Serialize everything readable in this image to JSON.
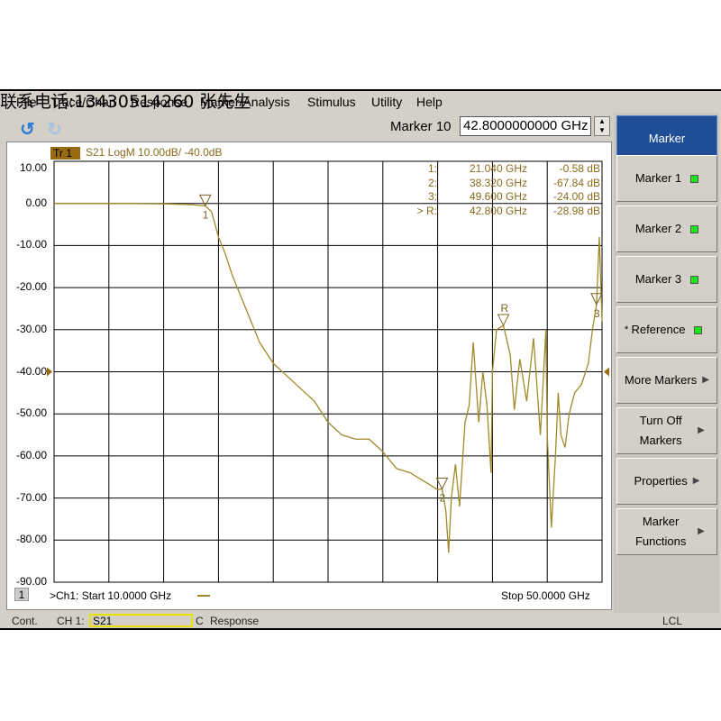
{
  "watermark": "联系电话:13430514260 张先生",
  "menu": [
    "File",
    "Trace/Chan",
    "Response",
    "Marker/Analysis",
    "Stimulus",
    "Utility",
    "Help"
  ],
  "toolbar": {
    "undo_icon": "undo-icon",
    "redo_icon": "redo-icon",
    "marker_label": "Marker 10",
    "marker_value": "42.8000000000 GHz"
  },
  "trace": {
    "tag": "Tr 1",
    "header": "S21 LogM 10.00dB/  -40.0dB",
    "color": "#a08a2a"
  },
  "y_ticks": [
    "10.00",
    "0.00",
    "-10.00",
    "-20.00",
    "-30.00",
    "-40.00",
    "-50.00",
    "-60.00",
    "-70.00",
    "-80.00",
    "-90.00"
  ],
  "markers_table": [
    {
      "id": "1:",
      "freq": "21.040 GHz",
      "val": "-0.58 dB"
    },
    {
      "id": "2:",
      "freq": "38.320 GHz",
      "val": "-67.84 dB"
    },
    {
      "id": "3:",
      "freq": "49.600 GHz",
      "val": "-24.00 dB"
    },
    {
      "id": "> R:",
      "freq": "42.800 GHz",
      "val": "-28.98 dB"
    }
  ],
  "footer": {
    "channel_num": "1",
    "start": ">Ch1:  Start  10.0000 GHz",
    "stop": "Stop  50.0000 GHz"
  },
  "status": {
    "mode": "Cont.",
    "channel": "CH 1:",
    "param": "S21",
    "cal": "C",
    "response": "Response",
    "remote": "LCL"
  },
  "softkeys": {
    "title": "Marker",
    "items": [
      {
        "label": "Marker 1",
        "led": true
      },
      {
        "label": "Marker 2",
        "led": true
      },
      {
        "label": "Marker 3",
        "led": true
      },
      {
        "label": "Reference",
        "led": true,
        "prefix": "*"
      },
      {
        "label": "More Markers",
        "arrow": true
      },
      {
        "label": "Turn Off Markers",
        "arrow": true
      },
      {
        "label": "Properties",
        "arrow": true
      },
      {
        "label": "Marker Functions",
        "arrow": true
      }
    ]
  },
  "chart_data": {
    "type": "line",
    "xlim": [
      10,
      50
    ],
    "ylim": [
      -90,
      10
    ],
    "x_unit": "GHz",
    "y_unit": "dB",
    "scale_per_div": "10.00dB",
    "ref_level": -40,
    "grid": true,
    "series": [
      {
        "name": "S21",
        "points": [
          [
            10,
            0
          ],
          [
            15,
            0
          ],
          [
            18,
            -0.1
          ],
          [
            20,
            -0.3
          ],
          [
            21.04,
            -0.58
          ],
          [
            21.5,
            -2
          ],
          [
            22,
            -8
          ],
          [
            22.5,
            -12
          ],
          [
            23,
            -17
          ],
          [
            24,
            -25
          ],
          [
            25,
            -33
          ],
          [
            26,
            -38
          ],
          [
            27,
            -41
          ],
          [
            28,
            -44
          ],
          [
            29,
            -47
          ],
          [
            30,
            -52
          ],
          [
            31,
            -55
          ],
          [
            32,
            -56
          ],
          [
            33,
            -56
          ],
          [
            34,
            -59
          ],
          [
            35,
            -63
          ],
          [
            36,
            -64
          ],
          [
            37,
            -66
          ],
          [
            38,
            -68
          ],
          [
            38.32,
            -67.84
          ],
          [
            38.6,
            -73
          ],
          [
            38.8,
            -83
          ],
          [
            39,
            -70
          ],
          [
            39.3,
            -62
          ],
          [
            39.6,
            -72
          ],
          [
            40,
            -52
          ],
          [
            40.3,
            -48
          ],
          [
            40.6,
            -33
          ],
          [
            41,
            -52
          ],
          [
            41.3,
            -40
          ],
          [
            41.6,
            -48
          ],
          [
            41.9,
            -64
          ],
          [
            42,
            -40
          ],
          [
            42.3,
            -30
          ],
          [
            42.8,
            -28.98
          ],
          [
            43.3,
            -36
          ],
          [
            43.6,
            -49
          ],
          [
            44,
            -37
          ],
          [
            44.5,
            -47
          ],
          [
            45,
            -32
          ],
          [
            45.5,
            -55
          ],
          [
            45.9,
            -30
          ],
          [
            46,
            -55
          ],
          [
            46.3,
            -77
          ],
          [
            46.6,
            -60
          ],
          [
            46.8,
            -45
          ],
          [
            47,
            -55
          ],
          [
            47.3,
            -58
          ],
          [
            47.6,
            -50
          ],
          [
            48,
            -45
          ],
          [
            48.5,
            -43
          ],
          [
            49,
            -38
          ],
          [
            49.3,
            -30
          ],
          [
            49.6,
            -24
          ],
          [
            49.8,
            -8
          ],
          [
            50,
            -28
          ]
        ]
      }
    ],
    "markers": [
      {
        "label": "1",
        "x": 21.04,
        "y": -0.58,
        "pos": "below"
      },
      {
        "label": "2",
        "x": 38.32,
        "y": -67.84,
        "pos": "below"
      },
      {
        "label": "3",
        "x": 49.6,
        "y": -24.0,
        "pos": "below"
      },
      {
        "label": "R",
        "x": 42.8,
        "y": -28.98,
        "pos": "above"
      }
    ]
  }
}
